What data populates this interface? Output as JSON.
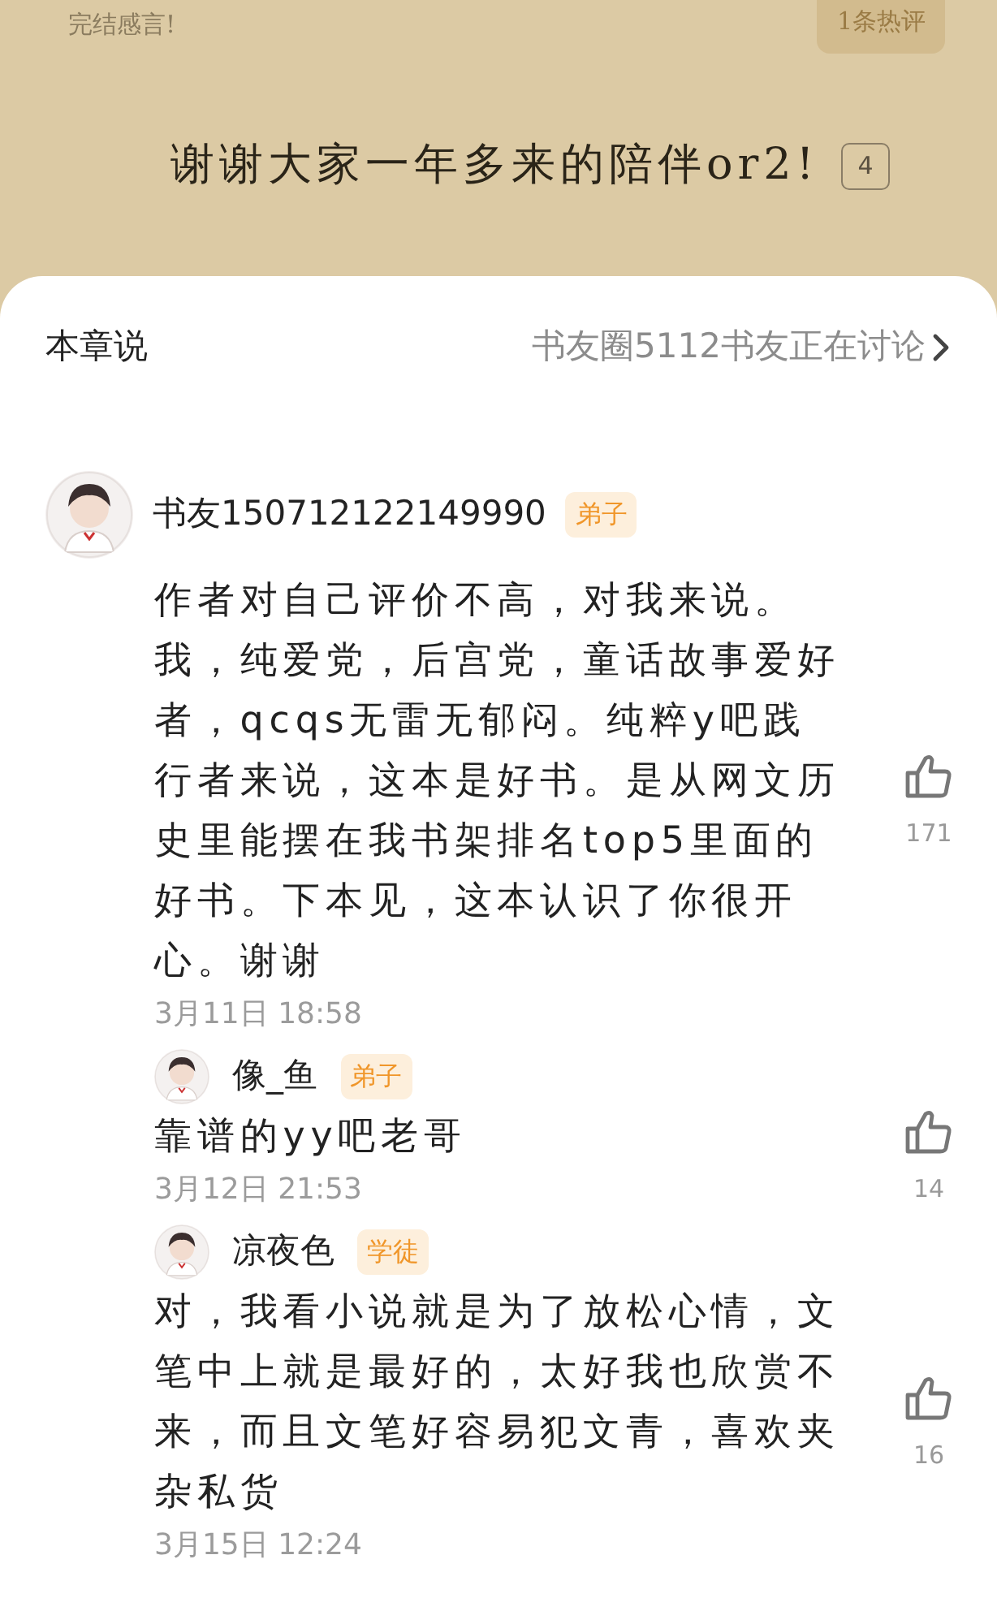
{
  "chapter_page": {
    "header": "完结感言!",
    "hot_comments_button": "1条热评",
    "paragraph": {
      "text": "谢谢大家一年多来的陪伴or2!",
      "comment_count": "4"
    }
  },
  "sheet": {
    "title": "本章说",
    "circle_link": "书友圈5112书友正在讨论",
    "comments": [
      {
        "user": "书友150712122149990",
        "badge": "弟子",
        "text": "作者对自己评价不高，对我来说。我，纯爱党，后宫党，童话故事爱好者，qcqs无雷无郁闷。纯粹y吧践行者来说，这本是好书。是从网文历史里能摆在我书架排名top5里面的好书。下本见，这本认识了你很开心。谢谢",
        "time": "3月11日 18:58",
        "likes": "171",
        "replies": [
          {
            "user": "像_鱼",
            "badge": "弟子",
            "text": "靠谱的yy吧老哥",
            "time": "3月12日 21:53",
            "likes": "14"
          },
          {
            "user": "凉夜色",
            "badge": "学徒",
            "text": "对，我看小说就是为了放松心情，文笔中上就是最好的，太好我也欣赏不来，而且文笔好容易犯文青，喜欢夹杂私货",
            "time": "3月15日 12:24",
            "likes": "16"
          }
        ]
      }
    ]
  }
}
